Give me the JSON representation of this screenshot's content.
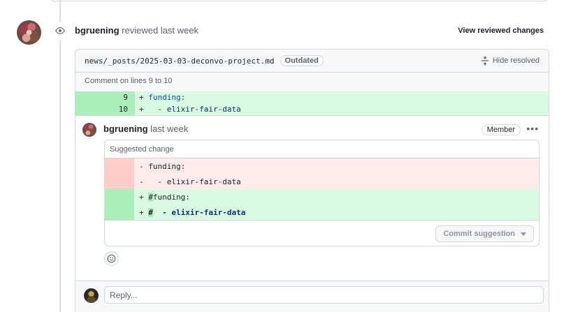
{
  "review": {
    "author": "bgruening",
    "action": "reviewed last week",
    "view_changes_label": "View reviewed changes"
  },
  "file": {
    "path": "news/_posts/2025-03-03-deconvo-project.md",
    "outdated_label": "Outdated",
    "hide_resolved_label": "Hide resolved"
  },
  "comment_on": "Comment on lines 9 to 10",
  "diff_lines": [
    {
      "num": "9",
      "sign": "+",
      "key": "funding",
      "rest": ":"
    },
    {
      "num": "10",
      "sign": "+",
      "key": "",
      "rest": "  - elixir-fair-data"
    }
  ],
  "comment": {
    "author": "bgruening",
    "time": "last week",
    "badge": "Member",
    "menu_icon": "kebab-horizontal-icon"
  },
  "suggestion": {
    "title": "Suggested change",
    "removed": [
      "- funding:",
      "-   - elixir-fair-data"
    ],
    "added_prefix": [
      "+ ",
      "+ "
    ],
    "added_hash": [
      "#",
      "#"
    ],
    "added_rest": [
      "funding:",
      "  - elixir-fair-data"
    ],
    "commit_label": "Commit suggestion"
  },
  "reply": {
    "placeholder": "Reply..."
  },
  "colors": {
    "addition_bg": "#dafbe1",
    "addition_gutter": "#aceebb",
    "deletion_bg": "#ffebe9",
    "deletion_gutter": "#ffcecb"
  }
}
